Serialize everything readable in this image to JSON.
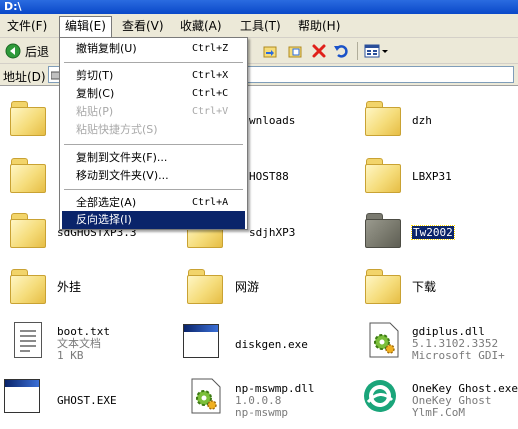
{
  "window": {
    "title": "D:\\"
  },
  "menu": [
    {
      "label": "文件(F)",
      "open": false
    },
    {
      "label": "编辑(E)",
      "open": true
    },
    {
      "label": "查看(V)",
      "open": false
    },
    {
      "label": "收藏(A)",
      "open": false
    },
    {
      "label": "工具(T)",
      "open": false
    },
    {
      "label": "帮助(H)",
      "open": false
    }
  ],
  "toolbar": {
    "back_label": "后退"
  },
  "address": {
    "label": "地址(D)"
  },
  "edit_menu": {
    "items": [
      {
        "label": "撤销复制(U)",
        "shortcut": "Ctrl+Z",
        "disabled": false
      },
      {
        "label": "剪切(T)",
        "shortcut": "Ctrl+X",
        "disabled": false
      },
      {
        "label": "复制(C)",
        "shortcut": "Ctrl+C",
        "disabled": false
      },
      {
        "label": "粘贴(P)",
        "shortcut": "Ctrl+V",
        "disabled": true
      },
      {
        "label": "粘贴快捷方式(S)",
        "shortcut": "",
        "disabled": true
      },
      {
        "label": "复制到文件夹(F)...",
        "shortcut": "",
        "disabled": false
      },
      {
        "label": "移动到文件夹(V)...",
        "shortcut": "",
        "disabled": false
      },
      {
        "label": "全部选定(A)",
        "shortcut": "Ctrl+A",
        "disabled": false
      },
      {
        "label": "反向选择(I)",
        "shortcut": "",
        "disabled": false,
        "highlighted": true
      }
    ]
  },
  "files": {
    "downloads": "wnloads",
    "dzh": "dzh",
    "ghost88": "HOST88",
    "lbxp31": "LBXP31",
    "sdghost": "sdGHOSTXP3.3",
    "sdjhxp3": "sdjhXP3",
    "tw2002": "Tw2002",
    "waigua": "外挂",
    "wangyou": "网游",
    "xiazai": "下载",
    "boot": {
      "name": "boot.txt",
      "type": "文本文档",
      "size": "1 KB"
    },
    "diskgen": "diskgen.exe",
    "gdiplus": {
      "name": "gdiplus.dll",
      "version": "5.1.3102.3352",
      "desc": "Microsoft GDI+"
    },
    "ghostexe": "GHOST.EXE",
    "npmswmp": {
      "name": "np-mswmp.dll",
      "version": "1.0.0.8",
      "desc": "np-mswmp"
    },
    "onekey": {
      "name": "OneKey Ghost.exe",
      "desc": "OneKey Ghost",
      "company": "YlmF.CoM"
    }
  },
  "colors": {
    "selection": "#0a246a",
    "folder": "#f5dc7a"
  }
}
